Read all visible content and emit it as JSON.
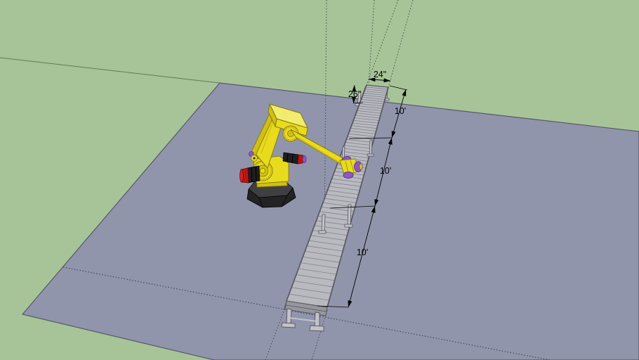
{
  "scene": {
    "kind": "3d-model-viewport",
    "objects": {
      "robot": "industrial-robot-arm",
      "conveyor": "roller-conveyor",
      "floor": "ground-plane"
    }
  },
  "annotations": {
    "conveyor_width": "24\"",
    "conveyor_height": "26\"",
    "sections": [
      {
        "label": "10'"
      },
      {
        "label": "10'"
      },
      {
        "label": "10'"
      }
    ]
  },
  "colors": {
    "background": "#a7c498",
    "horizon_line": "#5f7a58",
    "floor": "#9195ab",
    "floor_edge": "#565969",
    "floor_guide": "#3a3c4a",
    "construction": "#4a4a4a",
    "conveyor_belt": "#b9b9c0",
    "conveyor_line": "#82828c",
    "conveyor_side": "#8b8b93",
    "conveyor_end": "#96969e",
    "conveyor_frame": "#55555e",
    "conveyor_leg": "#c2c2c8",
    "robot_yellow": "#e8db1e",
    "robot_yellow_light": "#f2ec6e",
    "robot_yellow_dark": "#cfc013",
    "robot_outline": "#877a0c",
    "robot_base": "#232325",
    "robot_base_top": "#3f3f42",
    "robot_motor_red": "#c01212",
    "robot_joint_purple": "#8f55c9",
    "dimension_color": "#000000"
  }
}
